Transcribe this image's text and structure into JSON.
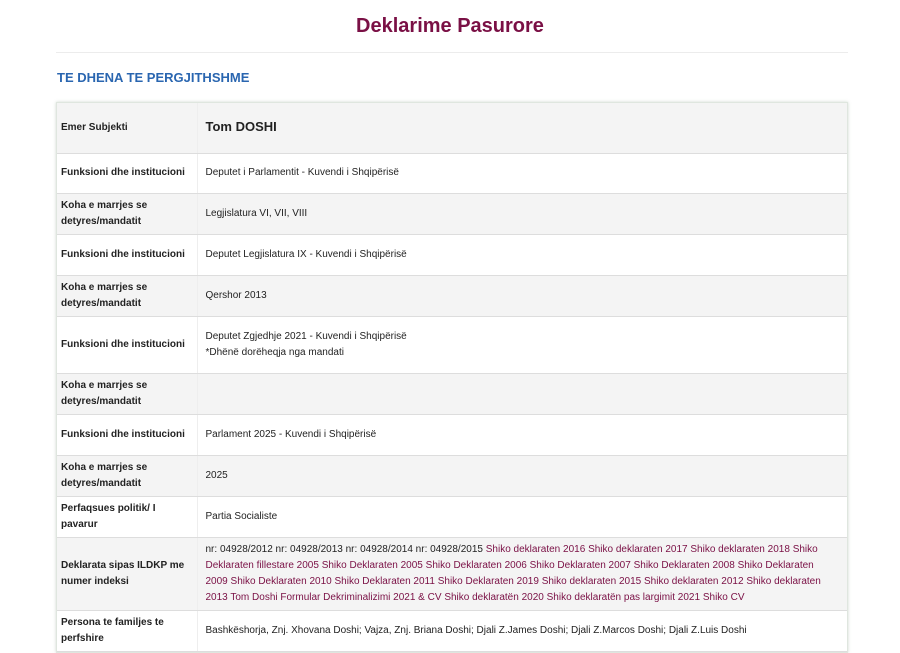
{
  "page": {
    "title": "Deklarime Pasurore",
    "section_heading": "TE DHENA TE PERGJITHSHME"
  },
  "rows": [
    {
      "label": "Emer Subjekti",
      "value": "Tom DOSHI"
    },
    {
      "label": "Funksioni dhe institucioni",
      "value": "Deputet i Parlamentit - Kuvendi i Shqipërisë"
    },
    {
      "label": "Koha e marrjes se detyres/mandatit",
      "value": "Legjislatura VI, VII, VIII"
    },
    {
      "label": "Funksioni dhe institucioni",
      "value": "Deputet Legjislatura IX - Kuvendi i Shqipërisë"
    },
    {
      "label": "Koha e marrjes se detyres/mandatit",
      "value": "Qershor 2013"
    },
    {
      "label": "Funksioni dhe institucioni",
      "value": "Deputet Zgjedhje 2021 - Kuvendi i Shqipërisë",
      "note": "*Dhënë dorëheqja nga mandati"
    },
    {
      "label": "Koha e marrjes se detyres/mandatit",
      "value": ""
    },
    {
      "label": "Funksioni dhe institucioni",
      "value": "Parlament 2025 - Kuvendi i Shqipërisë"
    },
    {
      "label": "Koha e marrjes se detyres/mandatit",
      "value": "2025"
    },
    {
      "label": "Perfaqsues politik/ I pavarur",
      "value": "Partia Socialiste"
    }
  ],
  "declarations": {
    "label": "Deklarata sipas ILDKP me numer indeksi",
    "index_numbers": "nr: 04928/2012 nr: 04928/2013 nr: 04928/2014 nr: 04928/2015",
    "links": [
      "Shiko deklaraten 2016",
      "Shiko deklaraten 2017",
      "Shiko deklaraten 2018",
      "Shiko Deklaraten fillestare 2005",
      "Shiko Deklaraten 2005",
      "Shiko Deklaraten 2006",
      "Shiko Deklaraten 2007",
      "Shiko Deklaraten 2008",
      "Shiko Deklaraten 2009",
      "Shiko Deklaraten 2010",
      "Shiko Deklaraten 2011",
      "Shiko Deklaraten 2019",
      "Shiko deklaraten 2015",
      "Shiko deklaraten 2012",
      "Shiko deklaraten 2013",
      "Tom Doshi Formular Dekriminalizimi 2021 & CV",
      "Shiko deklaratën 2020",
      "Shiko deklaratën pas largimit 2021",
      "Shiko CV"
    ]
  },
  "family": {
    "label": "Persona te familjes te perfshire",
    "value": "Bashkëshorja, Znj. Xhovana Doshi; Vajza, Znj. Briana Doshi; Djali Z.James Doshi; Djali Z.Marcos Doshi; Djali Z.Luis Doshi"
  }
}
